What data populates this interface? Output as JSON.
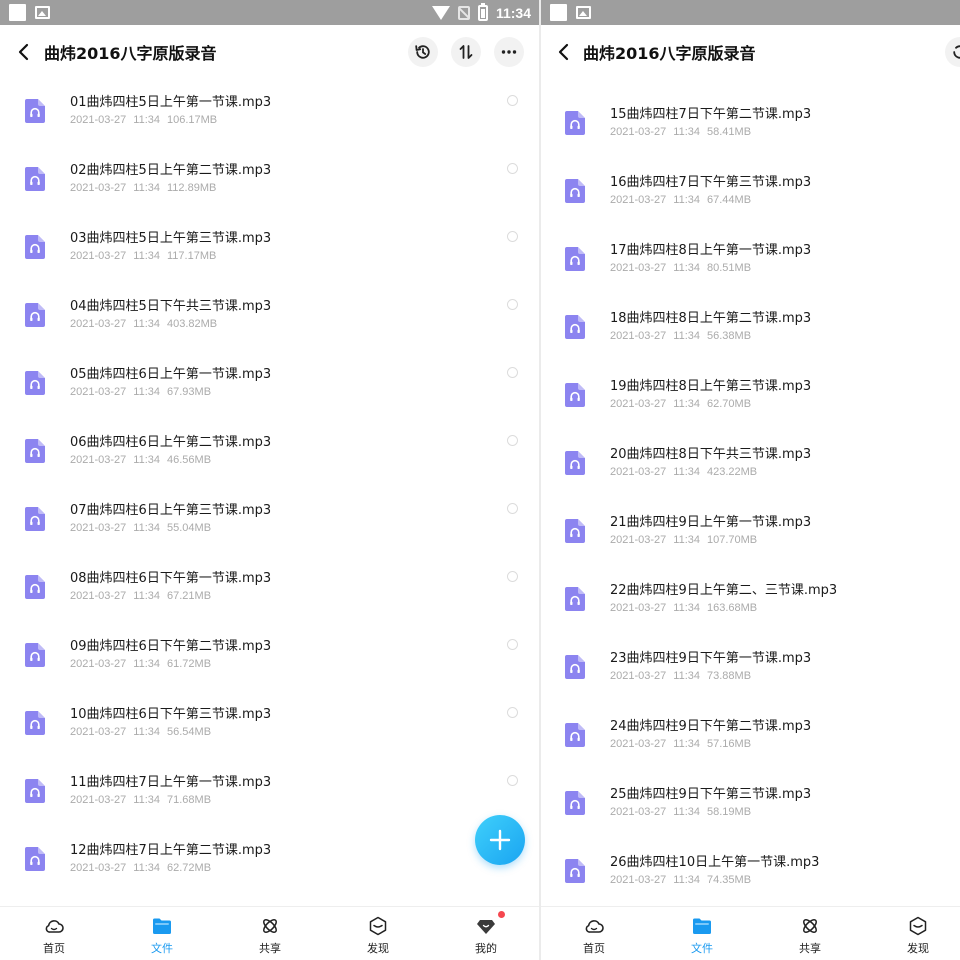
{
  "statusbar": {
    "time": "11:34"
  },
  "header": {
    "title": "曲炜2016八字原版录音"
  },
  "left_files": [
    {
      "name": "01曲炜四柱5日上午第一节课.mp3",
      "date": "2021-03-27",
      "time": "11:34",
      "size": "106.17MB"
    },
    {
      "name": "02曲炜四柱5日上午第二节课.mp3",
      "date": "2021-03-27",
      "time": "11:34",
      "size": "112.89MB"
    },
    {
      "name": "03曲炜四柱5日上午第三节课.mp3",
      "date": "2021-03-27",
      "time": "11:34",
      "size": "117.17MB"
    },
    {
      "name": "04曲炜四柱5日下午共三节课.mp3",
      "date": "2021-03-27",
      "time": "11:34",
      "size": "403.82MB"
    },
    {
      "name": "05曲炜四柱6日上午第一节课.mp3",
      "date": "2021-03-27",
      "time": "11:34",
      "size": "67.93MB"
    },
    {
      "name": "06曲炜四柱6日上午第二节课.mp3",
      "date": "2021-03-27",
      "time": "11:34",
      "size": "46.56MB"
    },
    {
      "name": "07曲炜四柱6日上午第三节课.mp3",
      "date": "2021-03-27",
      "time": "11:34",
      "size": "55.04MB"
    },
    {
      "name": "08曲炜四柱6日下午第一节课.mp3",
      "date": "2021-03-27",
      "time": "11:34",
      "size": "67.21MB"
    },
    {
      "name": "09曲炜四柱6日下午第二节课.mp3",
      "date": "2021-03-27",
      "time": "11:34",
      "size": "61.72MB"
    },
    {
      "name": "10曲炜四柱6日下午第三节课.mp3",
      "date": "2021-03-27",
      "time": "11:34",
      "size": "56.54MB"
    },
    {
      "name": "11曲炜四柱7日上午第一节课.mp3",
      "date": "2021-03-27",
      "time": "11:34",
      "size": "71.68MB"
    },
    {
      "name": "12曲炜四柱7日上午第二节课.mp3",
      "date": "2021-03-27",
      "time": "11:34",
      "size": "62.72MB"
    }
  ],
  "right_files": [
    {
      "name": "15曲炜四柱7日下午第二节课.mp3",
      "date": "2021-03-27",
      "time": "11:34",
      "size": "58.41MB"
    },
    {
      "name": "16曲炜四柱7日下午第三节课.mp3",
      "date": "2021-03-27",
      "time": "11:34",
      "size": "67.44MB"
    },
    {
      "name": "17曲炜四柱8日上午第一节课.mp3",
      "date": "2021-03-27",
      "time": "11:34",
      "size": "80.51MB"
    },
    {
      "name": "18曲炜四柱8日上午第二节课.mp3",
      "date": "2021-03-27",
      "time": "11:34",
      "size": "56.38MB"
    },
    {
      "name": "19曲炜四柱8日上午第三节课.mp3",
      "date": "2021-03-27",
      "time": "11:34",
      "size": "62.70MB"
    },
    {
      "name": "20曲炜四柱8日下午共三节课.mp3",
      "date": "2021-03-27",
      "time": "11:34",
      "size": "423.22MB"
    },
    {
      "name": "21曲炜四柱9日上午第一节课.mp3",
      "date": "2021-03-27",
      "time": "11:34",
      "size": "107.70MB"
    },
    {
      "name": "22曲炜四柱9日上午第二、三节课.mp3",
      "date": "2021-03-27",
      "time": "11:34",
      "size": "163.68MB"
    },
    {
      "name": "23曲炜四柱9日下午第一节课.mp3",
      "date": "2021-03-27",
      "time": "11:34",
      "size": "73.88MB"
    },
    {
      "name": "24曲炜四柱9日下午第二节课.mp3",
      "date": "2021-03-27",
      "time": "11:34",
      "size": "57.16MB"
    },
    {
      "name": "25曲炜四柱9日下午第三节课.mp3",
      "date": "2021-03-27",
      "time": "11:34",
      "size": "58.19MB"
    },
    {
      "name": "26曲炜四柱10日上午第一节课.mp3",
      "date": "2021-03-27",
      "time": "11:34",
      "size": "74.35MB"
    }
  ],
  "tabs": [
    {
      "label": "首页",
      "icon": "cloud-icon"
    },
    {
      "label": "文件",
      "icon": "folder-icon"
    },
    {
      "label": "共享",
      "icon": "share-icon"
    },
    {
      "label": "发现",
      "icon": "discover-icon"
    },
    {
      "label": "我的",
      "icon": "avatar-icon"
    }
  ],
  "active_tab": "文件",
  "colors": {
    "accent": "#1a9af0",
    "file_icon": "#8c84f0",
    "fab": "#28b6f6",
    "badge": "#f5474f"
  }
}
